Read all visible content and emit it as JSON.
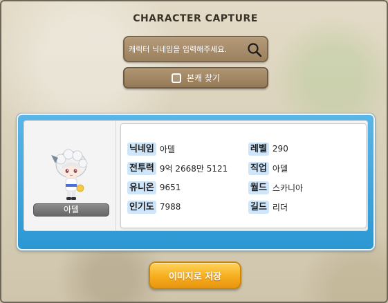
{
  "header": {
    "title": "CHARACTER CAPTURE"
  },
  "search": {
    "placeholder": "캐릭터 닉네임을 입력해주세요.",
    "icon": "search-icon"
  },
  "toggle": {
    "label": "본캐 찾기",
    "checked": false
  },
  "character": {
    "name_plate": "아델",
    "fields": [
      {
        "label": "닉네임",
        "value": "아델"
      },
      {
        "label": "레벨",
        "value": "290"
      },
      {
        "label": "전투력",
        "value": "9억 2668만 5121"
      },
      {
        "label": "직업",
        "value": "아델"
      },
      {
        "label": "유니온",
        "value": "9651"
      },
      {
        "label": "월드",
        "value": "스카니아"
      },
      {
        "label": "인기도",
        "value": "7988"
      },
      {
        "label": "길드",
        "value": "리더"
      }
    ]
  },
  "actions": {
    "save_label": "이미지로 저장"
  },
  "colors": {
    "card_blue": "#2b97d3",
    "label_bg": "#cfe6fa",
    "save_orange": "#f5ad1e",
    "search_brown": "#9c815f"
  }
}
